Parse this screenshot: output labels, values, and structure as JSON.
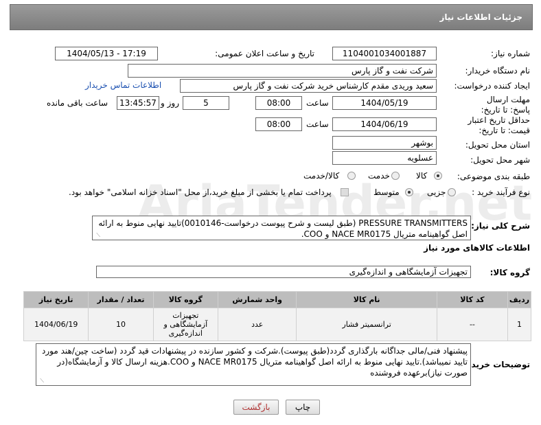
{
  "header": {
    "title": "جزئیات اطلاعات نیاز"
  },
  "fields": {
    "need_number_label": "شماره نیاز:",
    "need_number": "1104001034001887",
    "announce_label": "تاریخ و ساعت اعلان عمومی:",
    "announce_value": "1404/05/13 - 17:19",
    "buyer_org_label": "نام دستگاه خریدار:",
    "buyer_org": "شرکت نفت و گاز پارس",
    "creator_label": "ایجاد کننده درخواست:",
    "creator": "سعید وریدی مقدم کارشناس خرید شرکت نفت و گاز پارس",
    "contact_link": "اطلاعات تماس خریدار",
    "deadline_label": "مهلت ارسال پاسخ: تا تاریخ:",
    "deadline_date": "1404/05/19",
    "time_label": "ساعت",
    "deadline_time": "08:00",
    "days_value": "5",
    "days_label": "روز و",
    "remaining_time": "13:45:57",
    "remaining_label": "ساعت باقی مانده",
    "validity_label": "حداقل تاریخ اعتبار قیمت: تا تاریخ:",
    "validity_date": "1404/06/19",
    "validity_time_label": "ساعت",
    "validity_time": "08:00",
    "province_label": "استان محل تحویل:",
    "province": "بوشهر",
    "city_label": "شهر محل تحویل:",
    "city": "عسلویه",
    "category_label": "طبقه بندی موضوعی:",
    "category_options": [
      "کالا",
      "خدمت",
      "کالا/خدمت"
    ],
    "process_label": "نوع فرآیند خرید :",
    "process_options": [
      "جزیی",
      "متوسط"
    ],
    "payment_note": "پرداخت تمام یا بخشی از مبلغ خرید،از محل \"اسناد خزانه اسلامی\" خواهد بود."
  },
  "summary": {
    "label": "شرح کلی نیاز:",
    "text": "PRESSURE TRANSMITTERS (طبق لیست و شرح پیوست درخواست-0010146)تایید نهایی منوط به ارائه اصل گواهینامه متریال NACE MR0175 و COO."
  },
  "goods_info": {
    "title": "اطلاعات کالاهای مورد نیاز",
    "group_label": "گروه کالا:",
    "group_value": "تجهیزات آزمایشگاهی و اندازه‌گیری"
  },
  "table": {
    "headers": [
      "ردیف",
      "کد کالا",
      "نام کالا",
      "واحد شمارش",
      "گروه کالا",
      "تعداد / مقدار",
      "تاریخ نیاز"
    ],
    "rows": [
      [
        "1",
        "--",
        "ترانسمیتر فشار",
        "عدد",
        "تجهیزات آزمایشگاهی و اندازه‌گیری",
        "10",
        "1404/06/19"
      ]
    ]
  },
  "buyer_notes": {
    "label": "توضیحات خریدار:",
    "text": "پیشنهاد فنی/مالی جداگانه بارگذاری گردد(طبق پیوست).شرکت و کشور سازنده در پیشنهادات قید گردد (ساخت چین/هند مورد تایید نمیباشد).تایید نهایی منوط به ارائه اصل گواهینامه متریال NACE MR0175 و COO.هزینه ارسال کالا و آزمایشگاه(در صورت نیاز)برعهده فروشنده"
  },
  "buttons": {
    "print": "چاپ",
    "back": "بازگشت"
  }
}
